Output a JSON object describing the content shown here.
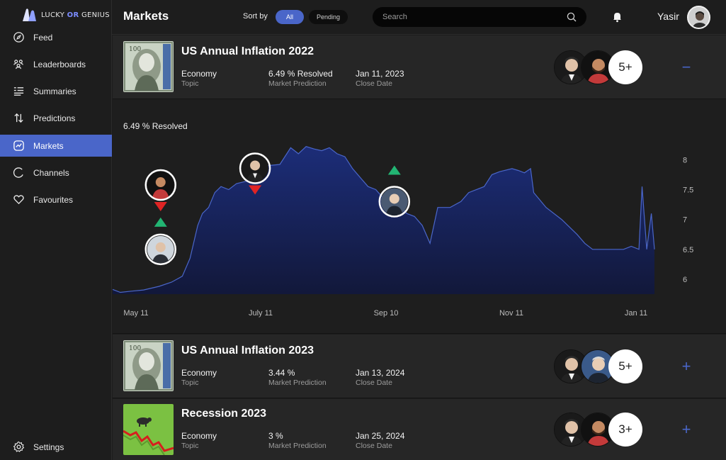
{
  "app": {
    "logo_text_left": "LUCKY ",
    "logo_text_or": "OR",
    "logo_text_right": " GENIUS"
  },
  "sidebar": {
    "items": [
      {
        "label": "Feed",
        "icon": "compass-icon"
      },
      {
        "label": "Leaderboards",
        "icon": "people-icon"
      },
      {
        "label": "Summaries",
        "icon": "list-icon"
      },
      {
        "label": "Predictions",
        "icon": "arrows-updown-icon"
      },
      {
        "label": "Markets",
        "icon": "chart-line-icon",
        "active": true
      },
      {
        "label": "Channels",
        "icon": "circle-icon"
      },
      {
        "label": "Favourites",
        "icon": "heart-icon"
      }
    ],
    "settings_label": "Settings"
  },
  "header": {
    "title": "Markets",
    "sort_label": "Sort by",
    "sort_options": [
      "All",
      "Pending"
    ],
    "sort_selected": "All",
    "search_placeholder": "Search",
    "username": "Yasir"
  },
  "markets": [
    {
      "title": "US Annual Inflation 2022",
      "topic_value": "Economy",
      "topic_label": "Topic",
      "prediction_value": "6.49 %  Resolved",
      "prediction_label": "Market Prediction",
      "close_value": "Jan 11, 2023",
      "close_label": "Close Date",
      "more_count": "5+",
      "expanded": true,
      "toggle": "−"
    },
    {
      "title": "US Annual Inflation 2023",
      "topic_value": "Economy",
      "topic_label": "Topic",
      "prediction_value": "3.44 %",
      "prediction_label": "Market Prediction",
      "close_value": "Jan 13, 2024",
      "close_label": "Close Date",
      "more_count": "5+",
      "expanded": false,
      "toggle": "+"
    },
    {
      "title": "Recession 2023",
      "topic_value": "Economy",
      "topic_label": "Topic",
      "prediction_value": "3 %",
      "prediction_label": "Market Prediction",
      "close_value": "Jan 25, 2024",
      "close_label": "Close Date",
      "more_count": "3+",
      "expanded": false,
      "toggle": "+"
    }
  ],
  "chart_data": {
    "type": "area",
    "title": "6.49 %  Resolved",
    "x_ticks": [
      "May 11",
      "July 11",
      "Sep 10",
      "Nov 11",
      "Jan 11"
    ],
    "y_ticks": [
      8,
      7.5,
      7,
      6.5,
      6
    ],
    "ylim": [
      5.75,
      8.3
    ],
    "x_range_days": [
      0,
      245
    ],
    "grid": false,
    "fill_color": "#1a2a66",
    "line_color": "#4a66c9",
    "values": [
      [
        0,
        5.83
      ],
      [
        5,
        5.78
      ],
      [
        12,
        5.8
      ],
      [
        20,
        5.82
      ],
      [
        30,
        5.88
      ],
      [
        38,
        5.95
      ],
      [
        45,
        6.05
      ],
      [
        50,
        6.35
      ],
      [
        55,
        6.9
      ],
      [
        58,
        7.1
      ],
      [
        62,
        7.2
      ],
      [
        66,
        7.45
      ],
      [
        70,
        7.55
      ],
      [
        75,
        7.5
      ],
      [
        80,
        7.6
      ],
      [
        88,
        7.65
      ],
      [
        95,
        7.7
      ],
      [
        100,
        7.9
      ],
      [
        108,
        7.92
      ],
      [
        115,
        8.2
      ],
      [
        120,
        8.1
      ],
      [
        125,
        8.22
      ],
      [
        130,
        8.18
      ],
      [
        135,
        8.15
      ],
      [
        140,
        8.2
      ],
      [
        145,
        8.1
      ],
      [
        150,
        8.05
      ],
      [
        155,
        7.85
      ],
      [
        160,
        7.7
      ],
      [
        165,
        7.55
      ],
      [
        170,
        7.5
      ],
      [
        175,
        7.35
      ],
      [
        180,
        7.3
      ],
      [
        185,
        7.25
      ],
      [
        190,
        7.1
      ],
      [
        195,
        7.05
      ],
      [
        200,
        6.9
      ],
      [
        205,
        6.6
      ],
      [
        210,
        7.2
      ],
      [
        218,
        7.2
      ],
      [
        225,
        7.3
      ],
      [
        230,
        7.45
      ],
      [
        240,
        7.55
      ],
      [
        245,
        7.75
      ],
      [
        250,
        7.8
      ],
      [
        258,
        7.85
      ],
      [
        262,
        7.82
      ],
      [
        266,
        7.78
      ],
      [
        270,
        7.85
      ],
      [
        272,
        7.45
      ],
      [
        280,
        7.2
      ],
      [
        290,
        7.0
      ],
      [
        300,
        6.75
      ],
      [
        305,
        6.6
      ],
      [
        310,
        6.5
      ],
      [
        320,
        6.5
      ],
      [
        330,
        6.5
      ],
      [
        335,
        6.55
      ],
      [
        340,
        6.5
      ],
      [
        342,
        7.55
      ],
      [
        345,
        6.5
      ],
      [
        348,
        7.1
      ],
      [
        350,
        6.5
      ]
    ],
    "markers": [
      {
        "x": 31,
        "y": 7.22,
        "direction": "down",
        "color": "#e02424",
        "avatar": "bearded-man-avatar"
      },
      {
        "x": 31,
        "y": 6.95,
        "direction": "up",
        "color": "#22b573",
        "avatar": "smiling-man-avatar"
      },
      {
        "x": 92,
        "y": 7.5,
        "direction": "down",
        "color": "#e02424",
        "avatar": "man-white-shirt-avatar"
      },
      {
        "x": 182,
        "y": 7.82,
        "direction": "up",
        "color": "#22b573",
        "avatar": "older-man-avatar"
      }
    ]
  }
}
